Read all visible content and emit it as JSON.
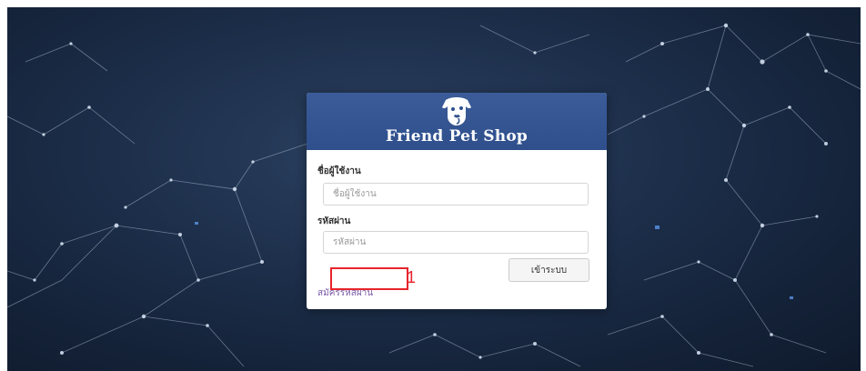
{
  "brand": {
    "title": "Friend Pet Shop",
    "logo_icon": "dog-head-icon",
    "header_color": "#34558f"
  },
  "form": {
    "username_label": "ชื่อผู้ใช้งาน",
    "username_placeholder": "ชื่อผู้ใช้งาน",
    "username_value": "",
    "password_label": "รหัสผ่าน",
    "password_placeholder": "รหัสผ่าน",
    "password_value": "",
    "login_button_label": "เข้าระบบ",
    "register_link_label": "สมัครรหัสผ่าน"
  },
  "annotation": {
    "number": "1",
    "color": "#e8242b"
  },
  "background": {
    "style": "constellation-network",
    "color": "#1d2f4b"
  }
}
